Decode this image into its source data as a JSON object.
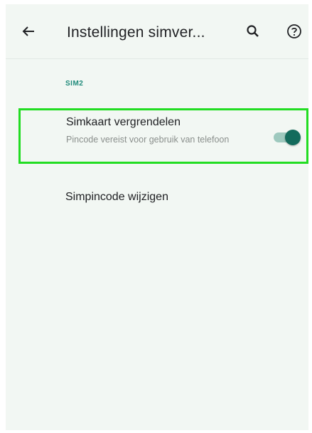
{
  "app_bar": {
    "title": "Instellingen simver...",
    "back_icon": "arrow-left-icon",
    "search_icon": "search-icon",
    "help_icon": "help-circle-icon"
  },
  "section": {
    "header": "SIM2"
  },
  "lock_sim": {
    "title": "Simkaart vergrendelen",
    "summary": "Pincode vereist voor gebruik van telefoon",
    "enabled": true
  },
  "change_pin": {
    "label": "Simpincode wijzigen"
  },
  "colors": {
    "background": "#f2f7f3",
    "accent": "#1f8a7a",
    "switch_thumb": "#136b5c",
    "switch_track": "#9ec9be",
    "highlight": "#22dd22"
  }
}
